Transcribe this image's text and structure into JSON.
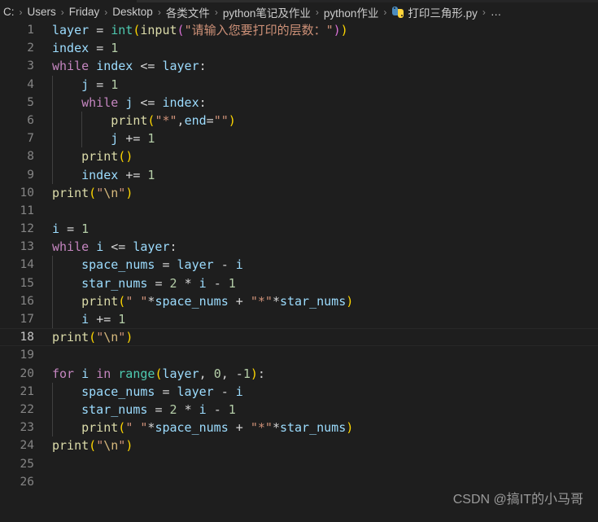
{
  "window": {
    "background_color": "#1e1e1e",
    "tab_bar_color": "#252526"
  },
  "breadcrumb": {
    "name": "breadcrumb",
    "separator": "›",
    "items": [
      {
        "label": "C:",
        "icon": ""
      },
      {
        "label": "Users",
        "icon": ""
      },
      {
        "label": "Friday",
        "icon": ""
      },
      {
        "label": "Desktop",
        "icon": ""
      },
      {
        "label": "各类文件",
        "icon": ""
      },
      {
        "label": "python笔记及作业",
        "icon": ""
      },
      {
        "label": "python作业",
        "icon": ""
      },
      {
        "label": "打印三角形.py",
        "icon": "python-file-icon"
      },
      {
        "label": "…",
        "icon": ""
      }
    ]
  },
  "editor": {
    "language": "python",
    "active_line": 18,
    "first_visible_line": 1,
    "last_visible_line": 26,
    "colors": {
      "keyword": "#c586c0",
      "variable": "#9cdcfe",
      "function": "#dcdcaa",
      "class": "#4ec9b0",
      "number": "#b5cea8",
      "string": "#ce9178",
      "escape": "#d7ba7d",
      "operator": "#d4d4d4",
      "line_number": "#858585",
      "line_number_active": "#c6c6c6",
      "indent_guide": "#404040"
    },
    "lines": [
      {
        "n": 1,
        "indent": 0,
        "text": "layer = int(input(\"请输入您要打印的层数：\"))"
      },
      {
        "n": 2,
        "indent": 0,
        "text": "index = 1"
      },
      {
        "n": 3,
        "indent": 0,
        "text": "while index <= layer:"
      },
      {
        "n": 4,
        "indent": 1,
        "text": "    j = 1"
      },
      {
        "n": 5,
        "indent": 1,
        "text": "    while j <= index:"
      },
      {
        "n": 6,
        "indent": 2,
        "text": "        print(\"*\",end=\"\")"
      },
      {
        "n": 7,
        "indent": 2,
        "text": "        j += 1"
      },
      {
        "n": 8,
        "indent": 1,
        "text": "    print()"
      },
      {
        "n": 9,
        "indent": 1,
        "text": "    index += 1"
      },
      {
        "n": 10,
        "indent": 0,
        "text": "print(\"\\n\")"
      },
      {
        "n": 11,
        "indent": 0,
        "text": ""
      },
      {
        "n": 12,
        "indent": 0,
        "text": "i = 1"
      },
      {
        "n": 13,
        "indent": 0,
        "text": "while i <= layer:"
      },
      {
        "n": 14,
        "indent": 1,
        "text": "    space_nums = layer - i"
      },
      {
        "n": 15,
        "indent": 1,
        "text": "    star_nums = 2 * i - 1"
      },
      {
        "n": 16,
        "indent": 1,
        "text": "    print(\" \"*space_nums + \"*\"*star_nums)"
      },
      {
        "n": 17,
        "indent": 1,
        "text": "    i += 1"
      },
      {
        "n": 18,
        "indent": 0,
        "text": "print(\"\\n\")"
      },
      {
        "n": 19,
        "indent": 0,
        "text": ""
      },
      {
        "n": 20,
        "indent": 0,
        "text": "for i in range(layer, 0, -1):"
      },
      {
        "n": 21,
        "indent": 1,
        "text": "    space_nums = layer - i"
      },
      {
        "n": 22,
        "indent": 1,
        "text": "    star_nums = 2 * i - 1"
      },
      {
        "n": 23,
        "indent": 1,
        "text": "    print(\" \"*space_nums + \"*\"*star_nums)"
      },
      {
        "n": 24,
        "indent": 0,
        "text": "print(\"\\n\")"
      },
      {
        "n": 25,
        "indent": 0,
        "text": ""
      },
      {
        "n": 26,
        "indent": 0,
        "text": ""
      }
    ],
    "tokens": [
      {
        "n": 1,
        "parts": [
          {
            "t": "layer",
            "c": "t-var"
          },
          {
            "t": " ",
            "c": "t-plain"
          },
          {
            "t": "=",
            "c": "t-op"
          },
          {
            "t": " ",
            "c": "t-plain"
          },
          {
            "t": "int",
            "c": "t-cls"
          },
          {
            "t": "(",
            "c": "t-paren1"
          },
          {
            "t": "input",
            "c": "t-fn"
          },
          {
            "t": "(",
            "c": "t-paren2"
          },
          {
            "t": "\"请输入您要打印的层数：\"",
            "c": "t-str"
          },
          {
            "t": ")",
            "c": "t-paren2"
          },
          {
            "t": ")",
            "c": "t-paren1"
          }
        ]
      },
      {
        "n": 2,
        "parts": [
          {
            "t": "index",
            "c": "t-var"
          },
          {
            "t": " ",
            "c": "t-plain"
          },
          {
            "t": "=",
            "c": "t-op"
          },
          {
            "t": " ",
            "c": "t-plain"
          },
          {
            "t": "1",
            "c": "t-num"
          }
        ]
      },
      {
        "n": 3,
        "parts": [
          {
            "t": "while",
            "c": "t-kw"
          },
          {
            "t": " ",
            "c": "t-plain"
          },
          {
            "t": "index",
            "c": "t-var"
          },
          {
            "t": " ",
            "c": "t-plain"
          },
          {
            "t": "<=",
            "c": "t-op"
          },
          {
            "t": " ",
            "c": "t-plain"
          },
          {
            "t": "layer",
            "c": "t-var"
          },
          {
            "t": ":",
            "c": "t-punc"
          }
        ]
      },
      {
        "n": 4,
        "parts": [
          {
            "t": "    ",
            "c": "t-plain"
          },
          {
            "t": "j",
            "c": "t-var"
          },
          {
            "t": " ",
            "c": "t-plain"
          },
          {
            "t": "=",
            "c": "t-op"
          },
          {
            "t": " ",
            "c": "t-plain"
          },
          {
            "t": "1",
            "c": "t-num"
          }
        ]
      },
      {
        "n": 5,
        "parts": [
          {
            "t": "    ",
            "c": "t-plain"
          },
          {
            "t": "while",
            "c": "t-kw"
          },
          {
            "t": " ",
            "c": "t-plain"
          },
          {
            "t": "j",
            "c": "t-var"
          },
          {
            "t": " ",
            "c": "t-plain"
          },
          {
            "t": "<=",
            "c": "t-op"
          },
          {
            "t": " ",
            "c": "t-plain"
          },
          {
            "t": "index",
            "c": "t-var"
          },
          {
            "t": ":",
            "c": "t-punc"
          }
        ]
      },
      {
        "n": 6,
        "parts": [
          {
            "t": "        ",
            "c": "t-plain"
          },
          {
            "t": "print",
            "c": "t-fn"
          },
          {
            "t": "(",
            "c": "t-paren1"
          },
          {
            "t": "\"*\"",
            "c": "t-str"
          },
          {
            "t": ",",
            "c": "t-punc"
          },
          {
            "t": "end",
            "c": "t-var"
          },
          {
            "t": "=",
            "c": "t-op"
          },
          {
            "t": "\"\"",
            "c": "t-str"
          },
          {
            "t": ")",
            "c": "t-paren1"
          }
        ]
      },
      {
        "n": 7,
        "parts": [
          {
            "t": "        ",
            "c": "t-plain"
          },
          {
            "t": "j",
            "c": "t-var"
          },
          {
            "t": " ",
            "c": "t-plain"
          },
          {
            "t": "+=",
            "c": "t-op"
          },
          {
            "t": " ",
            "c": "t-plain"
          },
          {
            "t": "1",
            "c": "t-num"
          }
        ]
      },
      {
        "n": 8,
        "parts": [
          {
            "t": "    ",
            "c": "t-plain"
          },
          {
            "t": "print",
            "c": "t-fn"
          },
          {
            "t": "(",
            "c": "t-paren1"
          },
          {
            "t": ")",
            "c": "t-paren1"
          }
        ]
      },
      {
        "n": 9,
        "parts": [
          {
            "t": "    ",
            "c": "t-plain"
          },
          {
            "t": "index",
            "c": "t-var"
          },
          {
            "t": " ",
            "c": "t-plain"
          },
          {
            "t": "+=",
            "c": "t-op"
          },
          {
            "t": " ",
            "c": "t-plain"
          },
          {
            "t": "1",
            "c": "t-num"
          }
        ]
      },
      {
        "n": 10,
        "parts": [
          {
            "t": "print",
            "c": "t-fn"
          },
          {
            "t": "(",
            "c": "t-paren1"
          },
          {
            "t": "\"",
            "c": "t-str"
          },
          {
            "t": "\\n",
            "c": "t-esc"
          },
          {
            "t": "\"",
            "c": "t-str"
          },
          {
            "t": ")",
            "c": "t-paren1"
          }
        ]
      },
      {
        "n": 11,
        "parts": []
      },
      {
        "n": 12,
        "parts": [
          {
            "t": "i",
            "c": "t-var"
          },
          {
            "t": " ",
            "c": "t-plain"
          },
          {
            "t": "=",
            "c": "t-op"
          },
          {
            "t": " ",
            "c": "t-plain"
          },
          {
            "t": "1",
            "c": "t-num"
          }
        ]
      },
      {
        "n": 13,
        "parts": [
          {
            "t": "while",
            "c": "t-kw"
          },
          {
            "t": " ",
            "c": "t-plain"
          },
          {
            "t": "i",
            "c": "t-var"
          },
          {
            "t": " ",
            "c": "t-plain"
          },
          {
            "t": "<=",
            "c": "t-op"
          },
          {
            "t": " ",
            "c": "t-plain"
          },
          {
            "t": "layer",
            "c": "t-var"
          },
          {
            "t": ":",
            "c": "t-punc"
          }
        ]
      },
      {
        "n": 14,
        "parts": [
          {
            "t": "    ",
            "c": "t-plain"
          },
          {
            "t": "space_nums",
            "c": "t-var"
          },
          {
            "t": " ",
            "c": "t-plain"
          },
          {
            "t": "=",
            "c": "t-op"
          },
          {
            "t": " ",
            "c": "t-plain"
          },
          {
            "t": "layer",
            "c": "t-var"
          },
          {
            "t": " ",
            "c": "t-plain"
          },
          {
            "t": "-",
            "c": "t-op"
          },
          {
            "t": " ",
            "c": "t-plain"
          },
          {
            "t": "i",
            "c": "t-var"
          }
        ]
      },
      {
        "n": 15,
        "parts": [
          {
            "t": "    ",
            "c": "t-plain"
          },
          {
            "t": "star_nums",
            "c": "t-var"
          },
          {
            "t": " ",
            "c": "t-plain"
          },
          {
            "t": "=",
            "c": "t-op"
          },
          {
            "t": " ",
            "c": "t-plain"
          },
          {
            "t": "2",
            "c": "t-num"
          },
          {
            "t": " ",
            "c": "t-plain"
          },
          {
            "t": "*",
            "c": "t-op"
          },
          {
            "t": " ",
            "c": "t-plain"
          },
          {
            "t": "i",
            "c": "t-var"
          },
          {
            "t": " ",
            "c": "t-plain"
          },
          {
            "t": "-",
            "c": "t-op"
          },
          {
            "t": " ",
            "c": "t-plain"
          },
          {
            "t": "1",
            "c": "t-num"
          }
        ]
      },
      {
        "n": 16,
        "parts": [
          {
            "t": "    ",
            "c": "t-plain"
          },
          {
            "t": "print",
            "c": "t-fn"
          },
          {
            "t": "(",
            "c": "t-paren1"
          },
          {
            "t": "\" \"",
            "c": "t-str"
          },
          {
            "t": "*",
            "c": "t-op"
          },
          {
            "t": "space_nums",
            "c": "t-var"
          },
          {
            "t": " ",
            "c": "t-plain"
          },
          {
            "t": "+",
            "c": "t-op"
          },
          {
            "t": " ",
            "c": "t-plain"
          },
          {
            "t": "\"*\"",
            "c": "t-str"
          },
          {
            "t": "*",
            "c": "t-op"
          },
          {
            "t": "star_nums",
            "c": "t-var"
          },
          {
            "t": ")",
            "c": "t-paren1"
          }
        ]
      },
      {
        "n": 17,
        "parts": [
          {
            "t": "    ",
            "c": "t-plain"
          },
          {
            "t": "i",
            "c": "t-var"
          },
          {
            "t": " ",
            "c": "t-plain"
          },
          {
            "t": "+=",
            "c": "t-op"
          },
          {
            "t": " ",
            "c": "t-plain"
          },
          {
            "t": "1",
            "c": "t-num"
          }
        ]
      },
      {
        "n": 18,
        "parts": [
          {
            "t": "print",
            "c": "t-fn"
          },
          {
            "t": "(",
            "c": "t-paren1"
          },
          {
            "t": "\"",
            "c": "t-str"
          },
          {
            "t": "\\n",
            "c": "t-esc"
          },
          {
            "t": "\"",
            "c": "t-str"
          },
          {
            "t": ")",
            "c": "t-paren1"
          }
        ]
      },
      {
        "n": 19,
        "parts": []
      },
      {
        "n": 20,
        "parts": [
          {
            "t": "for",
            "c": "t-kw"
          },
          {
            "t": " ",
            "c": "t-plain"
          },
          {
            "t": "i",
            "c": "t-var"
          },
          {
            "t": " ",
            "c": "t-plain"
          },
          {
            "t": "in",
            "c": "t-kw"
          },
          {
            "t": " ",
            "c": "t-plain"
          },
          {
            "t": "range",
            "c": "t-cls"
          },
          {
            "t": "(",
            "c": "t-paren1"
          },
          {
            "t": "layer",
            "c": "t-var"
          },
          {
            "t": ",",
            "c": "t-punc"
          },
          {
            "t": " ",
            "c": "t-plain"
          },
          {
            "t": "0",
            "c": "t-num"
          },
          {
            "t": ",",
            "c": "t-punc"
          },
          {
            "t": " ",
            "c": "t-plain"
          },
          {
            "t": "-",
            "c": "t-op"
          },
          {
            "t": "1",
            "c": "t-num"
          },
          {
            "t": ")",
            "c": "t-paren1"
          },
          {
            "t": ":",
            "c": "t-punc"
          }
        ]
      },
      {
        "n": 21,
        "parts": [
          {
            "t": "    ",
            "c": "t-plain"
          },
          {
            "t": "space_nums",
            "c": "t-var"
          },
          {
            "t": " ",
            "c": "t-plain"
          },
          {
            "t": "=",
            "c": "t-op"
          },
          {
            "t": " ",
            "c": "t-plain"
          },
          {
            "t": "layer",
            "c": "t-var"
          },
          {
            "t": " ",
            "c": "t-plain"
          },
          {
            "t": "-",
            "c": "t-op"
          },
          {
            "t": " ",
            "c": "t-plain"
          },
          {
            "t": "i",
            "c": "t-var"
          }
        ]
      },
      {
        "n": 22,
        "parts": [
          {
            "t": "    ",
            "c": "t-plain"
          },
          {
            "t": "star_nums",
            "c": "t-var"
          },
          {
            "t": " ",
            "c": "t-plain"
          },
          {
            "t": "=",
            "c": "t-op"
          },
          {
            "t": " ",
            "c": "t-plain"
          },
          {
            "t": "2",
            "c": "t-num"
          },
          {
            "t": " ",
            "c": "t-plain"
          },
          {
            "t": "*",
            "c": "t-op"
          },
          {
            "t": " ",
            "c": "t-plain"
          },
          {
            "t": "i",
            "c": "t-var"
          },
          {
            "t": " ",
            "c": "t-plain"
          },
          {
            "t": "-",
            "c": "t-op"
          },
          {
            "t": " ",
            "c": "t-plain"
          },
          {
            "t": "1",
            "c": "t-num"
          }
        ]
      },
      {
        "n": 23,
        "parts": [
          {
            "t": "    ",
            "c": "t-plain"
          },
          {
            "t": "print",
            "c": "t-fn"
          },
          {
            "t": "(",
            "c": "t-paren1"
          },
          {
            "t": "\" \"",
            "c": "t-str"
          },
          {
            "t": "*",
            "c": "t-op"
          },
          {
            "t": "space_nums",
            "c": "t-var"
          },
          {
            "t": " ",
            "c": "t-plain"
          },
          {
            "t": "+",
            "c": "t-op"
          },
          {
            "t": " ",
            "c": "t-plain"
          },
          {
            "t": "\"*\"",
            "c": "t-str"
          },
          {
            "t": "*",
            "c": "t-op"
          },
          {
            "t": "star_nums",
            "c": "t-var"
          },
          {
            "t": ")",
            "c": "t-paren1"
          }
        ]
      },
      {
        "n": 24,
        "parts": [
          {
            "t": "print",
            "c": "t-fn"
          },
          {
            "t": "(",
            "c": "t-paren1"
          },
          {
            "t": "\"",
            "c": "t-str"
          },
          {
            "t": "\\n",
            "c": "t-esc"
          },
          {
            "t": "\"",
            "c": "t-str"
          },
          {
            "t": ")",
            "c": "t-paren1"
          }
        ]
      },
      {
        "n": 25,
        "parts": []
      },
      {
        "n": 26,
        "parts": []
      }
    ]
  },
  "watermark": {
    "text": "CSDN @搞IT的小马哥"
  }
}
